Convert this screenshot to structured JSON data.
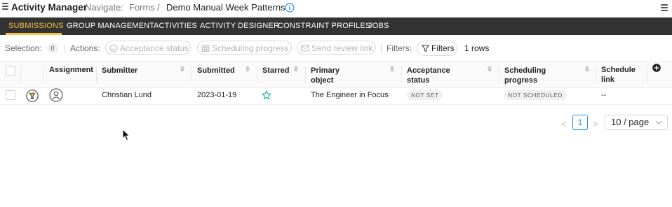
{
  "header": {
    "app_title": "Activity Manager",
    "navigate_label": "Navigate:",
    "breadcrumb": [
      "Forms",
      "Demo Manual Week Patterns"
    ],
    "breadcrumb_separator": "/"
  },
  "tabs": [
    {
      "label": "SUBMISSIONS",
      "active": true
    },
    {
      "label": "GROUP MANAGEMENT",
      "active": false
    },
    {
      "label": "ACTIVITIES",
      "active": false
    },
    {
      "label": "ACTIVITY DESIGNER",
      "active": false
    },
    {
      "label": "CONSTRAINT PROFILES",
      "active": false
    },
    {
      "label": "JOBS",
      "active": false
    }
  ],
  "toolbar": {
    "selection_label": "Selection:",
    "selection_count": "0",
    "actions_label": "Actions:",
    "acceptance_btn": "Acceptance status",
    "scheduling_btn": "Scheduling progress",
    "review_btn": "Send review link",
    "filters_label": "Filters:",
    "filters_btn": "Filters",
    "rows_count": "1 rows"
  },
  "table": {
    "columns": [
      "Assignment",
      "Submitter",
      "Submitted",
      "Starred",
      "Primary object",
      "Acceptance status",
      "Scheduling progress",
      "Schedule link"
    ],
    "rows": [
      {
        "submitter": "Christian Lund",
        "submitted": "2023-01-19",
        "starred": false,
        "primary_object": "The Engineer in Focus",
        "acceptance_status": "NOT SET",
        "scheduling_progress": "NOT SCHEDULED",
        "schedule_link": "--"
      }
    ]
  },
  "pagination": {
    "current_page": "1",
    "prev": "<",
    "next": ">",
    "page_size": "10 / page"
  },
  "colors": {
    "tab_bar": "#333333",
    "active_tab": "#f5c242",
    "primary": "#1890ff"
  }
}
